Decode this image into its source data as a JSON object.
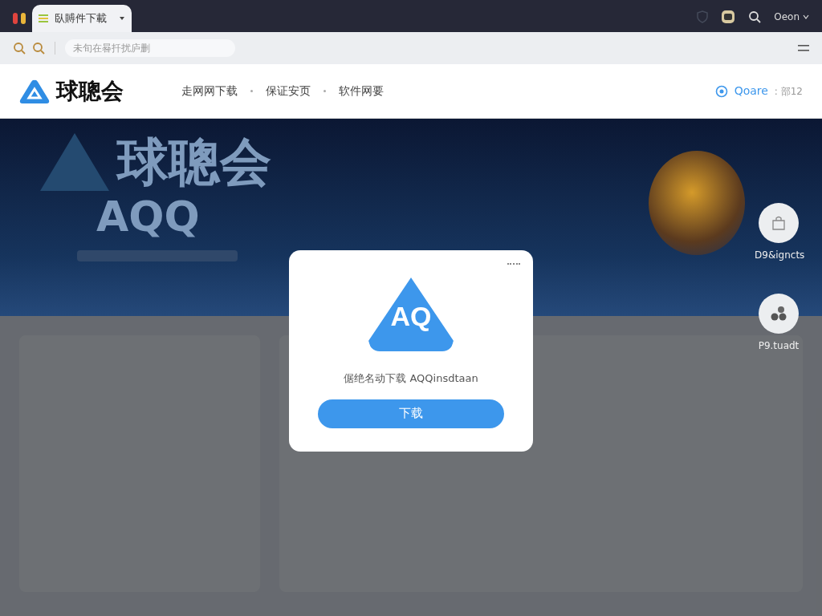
{
  "browser": {
    "tab": {
      "title": "臥賻件下載",
      "selected": true
    },
    "account": "Oeon",
    "address": {
      "placeholder": "未旬在晷扦扰庐删"
    }
  },
  "site": {
    "logo": "球聰会",
    "nav": [
      {
        "label": "走网网下载"
      },
      {
        "label": "保证安页"
      },
      {
        "label": "软件网要"
      }
    ],
    "user": "Qoare",
    "extra": ": 部12"
  },
  "hero": {
    "title": "球聰会",
    "subtitle": "AQQ"
  },
  "side_actions": [
    {
      "label": "D9&igncts",
      "kind": "bag"
    },
    {
      "label": "P9.tuadt",
      "kind": "cluster"
    }
  ],
  "modal": {
    "logo": "AQ",
    "message": "倨绝名动下载  AQQinsdtaan",
    "button": "下载"
  }
}
